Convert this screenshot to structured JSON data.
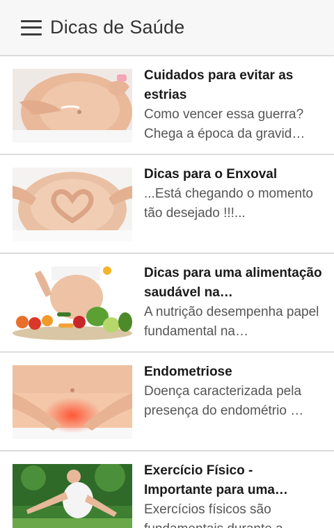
{
  "app_bar": {
    "title": "Dicas de Saúde",
    "menu_icon": "hamburger-menu-icon"
  },
  "articles": [
    {
      "title": "Cuidados para evitar as estrias",
      "description": "Como vencer essa guerra? Chega a época da gravid…",
      "image": "pregnant-belly-cream-image"
    },
    {
      "title": "Dicas para o Enxoval",
      "description": "...Está chegando o momento tão desejado !!!...",
      "image": "pregnant-belly-heart-hands-image"
    },
    {
      "title": "Dicas para uma alimentação saudável na…",
      "description": "A nutrição desempenha papel fundamental na…",
      "image": "pregnant-belly-vegetables-image"
    },
    {
      "title": "Endometriose",
      "description": "Doença caracterizada pela presença do endométrio …",
      "image": "abdomen-pain-hands-image"
    },
    {
      "title": "Exercício Físico - Importante para uma…",
      "description": "Exercícios físicos são fundamentais durante a…",
      "image": "pregnant-woman-exercise-image"
    }
  ],
  "colors": {
    "app_bar_bg": "#f7f7f7",
    "title_text": "#1a1a1a",
    "description_text": "#555555",
    "divider": "#dcdcdc"
  }
}
